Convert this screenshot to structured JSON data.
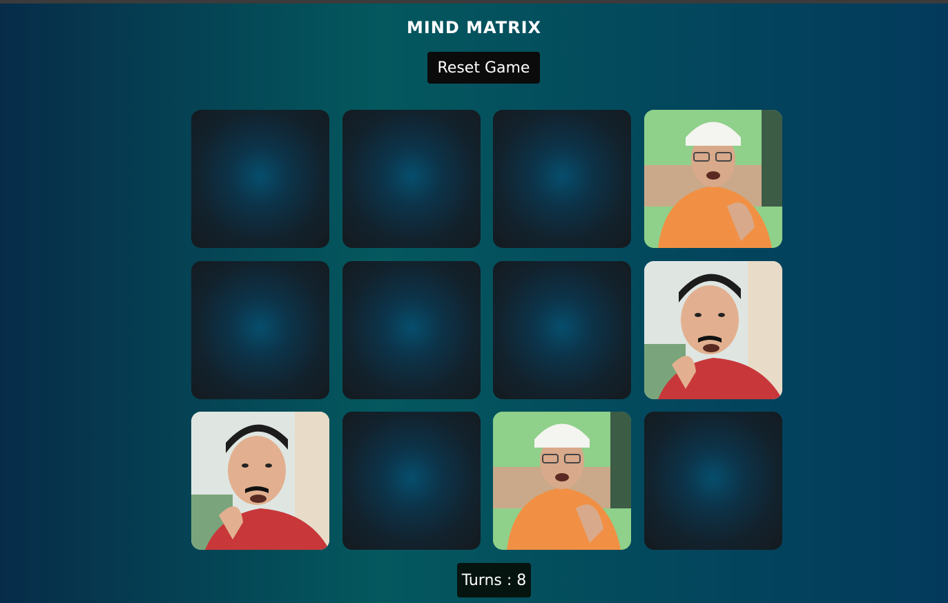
{
  "game": {
    "title": "MIND MATRIX",
    "reset_label": "Reset Game",
    "turns_label": "Turns : 8"
  },
  "colors": {
    "card_back_center": "#064e6c",
    "card_back_edge": "#151a1f",
    "button_bg": "#0b0b0b"
  },
  "cards": [
    {
      "state": "hidden"
    },
    {
      "state": "hidden"
    },
    {
      "state": "hidden"
    },
    {
      "state": "revealed",
      "image": "old-man-white-cap"
    },
    {
      "state": "hidden"
    },
    {
      "state": "hidden"
    },
    {
      "state": "hidden"
    },
    {
      "state": "revealed",
      "image": "man-pointing-mustache"
    },
    {
      "state": "revealed",
      "image": "man-pointing-mustache"
    },
    {
      "state": "hidden"
    },
    {
      "state": "revealed",
      "image": "old-man-white-cap"
    },
    {
      "state": "hidden"
    }
  ]
}
